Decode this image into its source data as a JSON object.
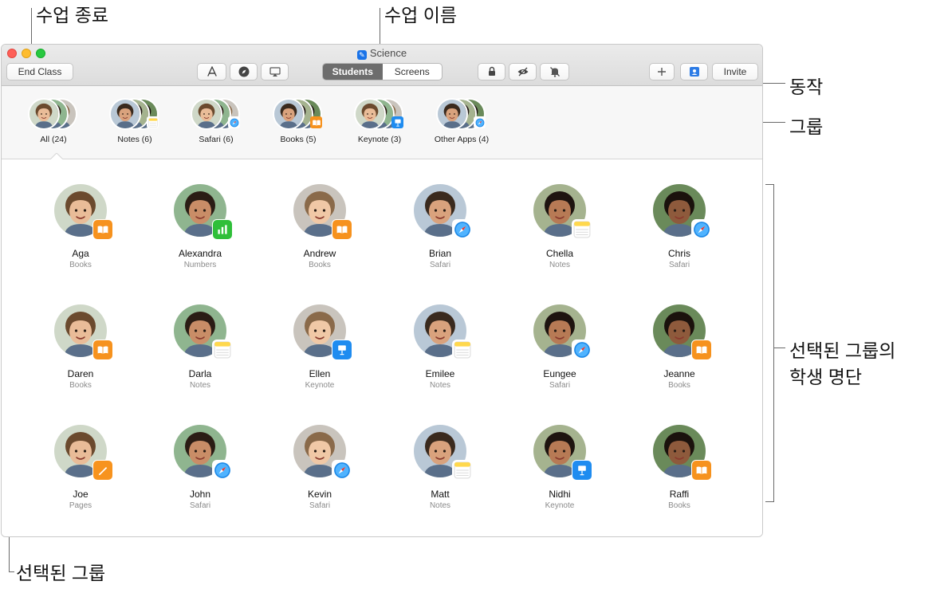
{
  "annotations": {
    "end_class": "수업 종료",
    "class_name": "수업 이름",
    "actions": "동작",
    "groups": "그룹",
    "students_line1": "선택된 그룹의",
    "students_line2": "학생 명단",
    "selected_group": "선택된 그룹"
  },
  "window": {
    "title": "Science",
    "end_class_label": "End Class",
    "tabs": {
      "students": "Students",
      "screens": "Screens",
      "selected": "Students"
    },
    "invite_label": "Invite",
    "toolbar_icons": [
      "app-store-icon",
      "safari-compass-icon",
      "airplay-icon",
      "lock-icon",
      "hide-eye-icon",
      "mute-icon",
      "plus-icon",
      "classroom-icon"
    ]
  },
  "groups": [
    {
      "label": "All (24)",
      "badge": ""
    },
    {
      "label": "Notes (6)",
      "badge": "notes"
    },
    {
      "label": "Safari (6)",
      "badge": "safari"
    },
    {
      "label": "Books (5)",
      "badge": "books"
    },
    {
      "label": "Keynote (3)",
      "badge": "keynote"
    },
    {
      "label": "Other Apps (4)",
      "badge": "safari"
    }
  ],
  "selected_group": "All (24)",
  "students": [
    {
      "name": "Aga",
      "app": "Books",
      "icon": "books"
    },
    {
      "name": "Alexandra",
      "app": "Numbers",
      "icon": "numbers"
    },
    {
      "name": "Andrew",
      "app": "Books",
      "icon": "books"
    },
    {
      "name": "Brian",
      "app": "Safari",
      "icon": "safari"
    },
    {
      "name": "Chella",
      "app": "Notes",
      "icon": "notes"
    },
    {
      "name": "Chris",
      "app": "Safari",
      "icon": "safari"
    },
    {
      "name": "Daren",
      "app": "Books",
      "icon": "books"
    },
    {
      "name": "Darla",
      "app": "Notes",
      "icon": "notes"
    },
    {
      "name": "Ellen",
      "app": "Keynote",
      "icon": "keynote"
    },
    {
      "name": "Emilee",
      "app": "Notes",
      "icon": "notes"
    },
    {
      "name": "Eungee",
      "app": "Safari",
      "icon": "safari"
    },
    {
      "name": "Jeanne",
      "app": "Books",
      "icon": "books"
    },
    {
      "name": "Joe",
      "app": "Pages",
      "icon": "pages"
    },
    {
      "name": "John",
      "app": "Safari",
      "icon": "safari"
    },
    {
      "name": "Kevin",
      "app": "Safari",
      "icon": "safari"
    },
    {
      "name": "Matt",
      "app": "Notes",
      "icon": "notes"
    },
    {
      "name": "Nidhi",
      "app": "Keynote",
      "icon": "keynote"
    },
    {
      "name": "Raffi",
      "app": "Books",
      "icon": "books"
    }
  ]
}
